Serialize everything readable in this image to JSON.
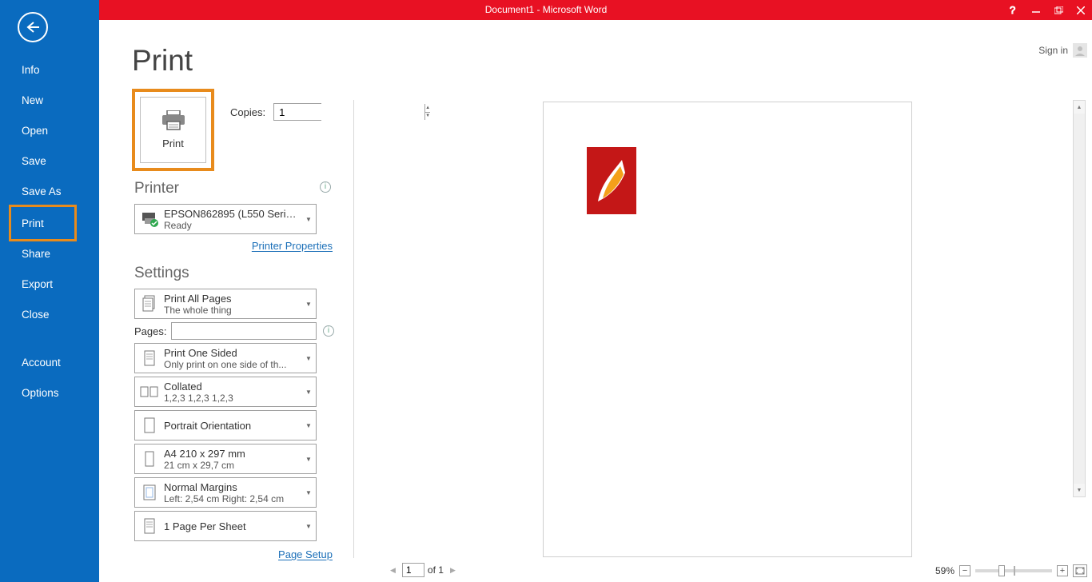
{
  "titlebar": {
    "title": "Document1 -  Microsoft Word"
  },
  "signin": {
    "label": "Sign in"
  },
  "sidebar": {
    "items": [
      {
        "label": "Info"
      },
      {
        "label": "New"
      },
      {
        "label": "Open"
      },
      {
        "label": "Save"
      },
      {
        "label": "Save As"
      },
      {
        "label": "Print"
      },
      {
        "label": "Share"
      },
      {
        "label": "Export"
      },
      {
        "label": "Close"
      }
    ],
    "accounts": {
      "label": "Account"
    },
    "options": {
      "label": "Options"
    }
  },
  "page": {
    "title": "Print"
  },
  "printBtn": {
    "label": "Print"
  },
  "copies": {
    "label": "Copies:",
    "value": "1"
  },
  "printerHeading": "Printer",
  "printer": {
    "name": "EPSON862895 (L550 Series)",
    "status": "Ready",
    "propsLink": "Printer Properties"
  },
  "settingsHeading": "Settings",
  "settings": {
    "range": {
      "line1": "Print All Pages",
      "line2": "The whole thing"
    },
    "pagesLabel": "Pages:",
    "pagesValue": "",
    "sided": {
      "line1": "Print One Sided",
      "line2": "Only print on one side of th..."
    },
    "collate": {
      "line1": "Collated",
      "line2": "1,2,3    1,2,3    1,2,3"
    },
    "orient": {
      "line1": "Portrait Orientation"
    },
    "paper": {
      "line1": "A4 210 x 297 mm",
      "line2": "21 cm x 29,7 cm"
    },
    "margins": {
      "line1": "Normal Margins",
      "line2": "Left:  2,54 cm   Right:  2,54 cm"
    },
    "ppsheet": {
      "line1": "1 Page Per Sheet"
    },
    "pageSetupLink": "Page Setup"
  },
  "previewNav": {
    "page": "1",
    "of": "of 1"
  },
  "zoom": {
    "pct": "59%"
  }
}
